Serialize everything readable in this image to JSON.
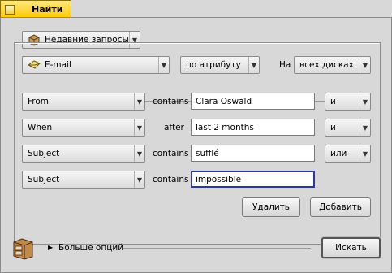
{
  "window": {
    "title": "Найти"
  },
  "recent": {
    "label": "Недавние запросы"
  },
  "type_menu": {
    "label": "E-mail"
  },
  "mode_menu": {
    "label": "по атрибуту"
  },
  "on_label": "На",
  "volume_menu": {
    "label": "всех дисках"
  },
  "rows": [
    {
      "attribute": "From",
      "operator": "contains",
      "value": "Clara Oswald",
      "combiner": "и"
    },
    {
      "attribute": "When",
      "operator": "after",
      "value": "last 2 months",
      "combiner": "и"
    },
    {
      "attribute": "Subject",
      "operator": "contains",
      "value": "sufflé",
      "combiner": "или"
    },
    {
      "attribute": "Subject",
      "operator": "contains",
      "value": "impossible"
    }
  ],
  "buttons": {
    "remove": "Удалить",
    "add": "Добавить",
    "search": "Искать"
  },
  "more_options": "Больше опций",
  "icons": {
    "recent": "box-icon",
    "type": "email-envelope-icon",
    "footer": "file-cabinet-icon",
    "disclosure": "triangle-right-icon"
  },
  "colors": {
    "tab": "#ffcb00",
    "background": "#d8d8d8",
    "focus": "#2a3a9a"
  }
}
